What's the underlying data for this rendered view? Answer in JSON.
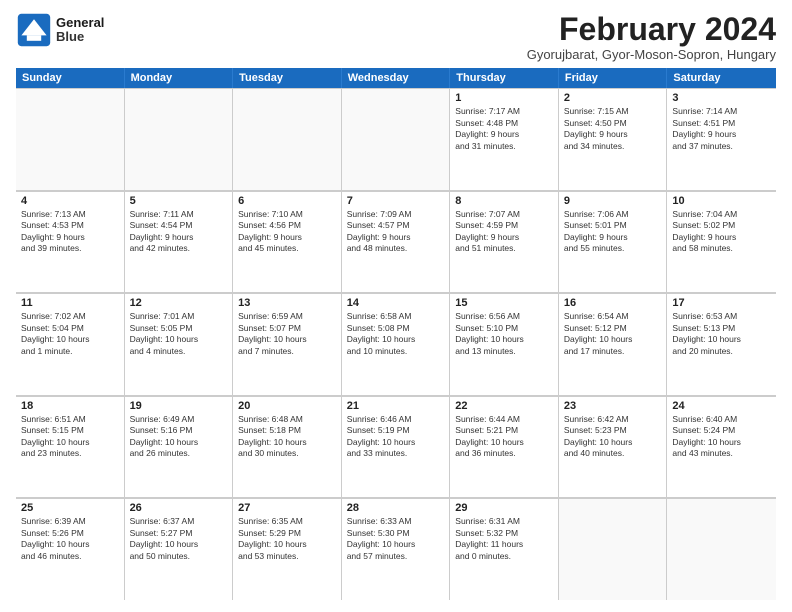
{
  "logo": {
    "line1": "General",
    "line2": "Blue"
  },
  "title": "February 2024",
  "location": "Gyorujbarat, Gyor-Moson-Sopron, Hungary",
  "weekdays": [
    "Sunday",
    "Monday",
    "Tuesday",
    "Wednesday",
    "Thursday",
    "Friday",
    "Saturday"
  ],
  "weeks": [
    [
      {
        "day": "",
        "lines": []
      },
      {
        "day": "",
        "lines": []
      },
      {
        "day": "",
        "lines": []
      },
      {
        "day": "",
        "lines": []
      },
      {
        "day": "1",
        "lines": [
          "Sunrise: 7:17 AM",
          "Sunset: 4:48 PM",
          "Daylight: 9 hours",
          "and 31 minutes."
        ]
      },
      {
        "day": "2",
        "lines": [
          "Sunrise: 7:15 AM",
          "Sunset: 4:50 PM",
          "Daylight: 9 hours",
          "and 34 minutes."
        ]
      },
      {
        "day": "3",
        "lines": [
          "Sunrise: 7:14 AM",
          "Sunset: 4:51 PM",
          "Daylight: 9 hours",
          "and 37 minutes."
        ]
      }
    ],
    [
      {
        "day": "4",
        "lines": [
          "Sunrise: 7:13 AM",
          "Sunset: 4:53 PM",
          "Daylight: 9 hours",
          "and 39 minutes."
        ]
      },
      {
        "day": "5",
        "lines": [
          "Sunrise: 7:11 AM",
          "Sunset: 4:54 PM",
          "Daylight: 9 hours",
          "and 42 minutes."
        ]
      },
      {
        "day": "6",
        "lines": [
          "Sunrise: 7:10 AM",
          "Sunset: 4:56 PM",
          "Daylight: 9 hours",
          "and 45 minutes."
        ]
      },
      {
        "day": "7",
        "lines": [
          "Sunrise: 7:09 AM",
          "Sunset: 4:57 PM",
          "Daylight: 9 hours",
          "and 48 minutes."
        ]
      },
      {
        "day": "8",
        "lines": [
          "Sunrise: 7:07 AM",
          "Sunset: 4:59 PM",
          "Daylight: 9 hours",
          "and 51 minutes."
        ]
      },
      {
        "day": "9",
        "lines": [
          "Sunrise: 7:06 AM",
          "Sunset: 5:01 PM",
          "Daylight: 9 hours",
          "and 55 minutes."
        ]
      },
      {
        "day": "10",
        "lines": [
          "Sunrise: 7:04 AM",
          "Sunset: 5:02 PM",
          "Daylight: 9 hours",
          "and 58 minutes."
        ]
      }
    ],
    [
      {
        "day": "11",
        "lines": [
          "Sunrise: 7:02 AM",
          "Sunset: 5:04 PM",
          "Daylight: 10 hours",
          "and 1 minute."
        ]
      },
      {
        "day": "12",
        "lines": [
          "Sunrise: 7:01 AM",
          "Sunset: 5:05 PM",
          "Daylight: 10 hours",
          "and 4 minutes."
        ]
      },
      {
        "day": "13",
        "lines": [
          "Sunrise: 6:59 AM",
          "Sunset: 5:07 PM",
          "Daylight: 10 hours",
          "and 7 minutes."
        ]
      },
      {
        "day": "14",
        "lines": [
          "Sunrise: 6:58 AM",
          "Sunset: 5:08 PM",
          "Daylight: 10 hours",
          "and 10 minutes."
        ]
      },
      {
        "day": "15",
        "lines": [
          "Sunrise: 6:56 AM",
          "Sunset: 5:10 PM",
          "Daylight: 10 hours",
          "and 13 minutes."
        ]
      },
      {
        "day": "16",
        "lines": [
          "Sunrise: 6:54 AM",
          "Sunset: 5:12 PM",
          "Daylight: 10 hours",
          "and 17 minutes."
        ]
      },
      {
        "day": "17",
        "lines": [
          "Sunrise: 6:53 AM",
          "Sunset: 5:13 PM",
          "Daylight: 10 hours",
          "and 20 minutes."
        ]
      }
    ],
    [
      {
        "day": "18",
        "lines": [
          "Sunrise: 6:51 AM",
          "Sunset: 5:15 PM",
          "Daylight: 10 hours",
          "and 23 minutes."
        ]
      },
      {
        "day": "19",
        "lines": [
          "Sunrise: 6:49 AM",
          "Sunset: 5:16 PM",
          "Daylight: 10 hours",
          "and 26 minutes."
        ]
      },
      {
        "day": "20",
        "lines": [
          "Sunrise: 6:48 AM",
          "Sunset: 5:18 PM",
          "Daylight: 10 hours",
          "and 30 minutes."
        ]
      },
      {
        "day": "21",
        "lines": [
          "Sunrise: 6:46 AM",
          "Sunset: 5:19 PM",
          "Daylight: 10 hours",
          "and 33 minutes."
        ]
      },
      {
        "day": "22",
        "lines": [
          "Sunrise: 6:44 AM",
          "Sunset: 5:21 PM",
          "Daylight: 10 hours",
          "and 36 minutes."
        ]
      },
      {
        "day": "23",
        "lines": [
          "Sunrise: 6:42 AM",
          "Sunset: 5:23 PM",
          "Daylight: 10 hours",
          "and 40 minutes."
        ]
      },
      {
        "day": "24",
        "lines": [
          "Sunrise: 6:40 AM",
          "Sunset: 5:24 PM",
          "Daylight: 10 hours",
          "and 43 minutes."
        ]
      }
    ],
    [
      {
        "day": "25",
        "lines": [
          "Sunrise: 6:39 AM",
          "Sunset: 5:26 PM",
          "Daylight: 10 hours",
          "and 46 minutes."
        ]
      },
      {
        "day": "26",
        "lines": [
          "Sunrise: 6:37 AM",
          "Sunset: 5:27 PM",
          "Daylight: 10 hours",
          "and 50 minutes."
        ]
      },
      {
        "day": "27",
        "lines": [
          "Sunrise: 6:35 AM",
          "Sunset: 5:29 PM",
          "Daylight: 10 hours",
          "and 53 minutes."
        ]
      },
      {
        "day": "28",
        "lines": [
          "Sunrise: 6:33 AM",
          "Sunset: 5:30 PM",
          "Daylight: 10 hours",
          "and 57 minutes."
        ]
      },
      {
        "day": "29",
        "lines": [
          "Sunrise: 6:31 AM",
          "Sunset: 5:32 PM",
          "Daylight: 11 hours",
          "and 0 minutes."
        ]
      },
      {
        "day": "",
        "lines": []
      },
      {
        "day": "",
        "lines": []
      }
    ]
  ]
}
